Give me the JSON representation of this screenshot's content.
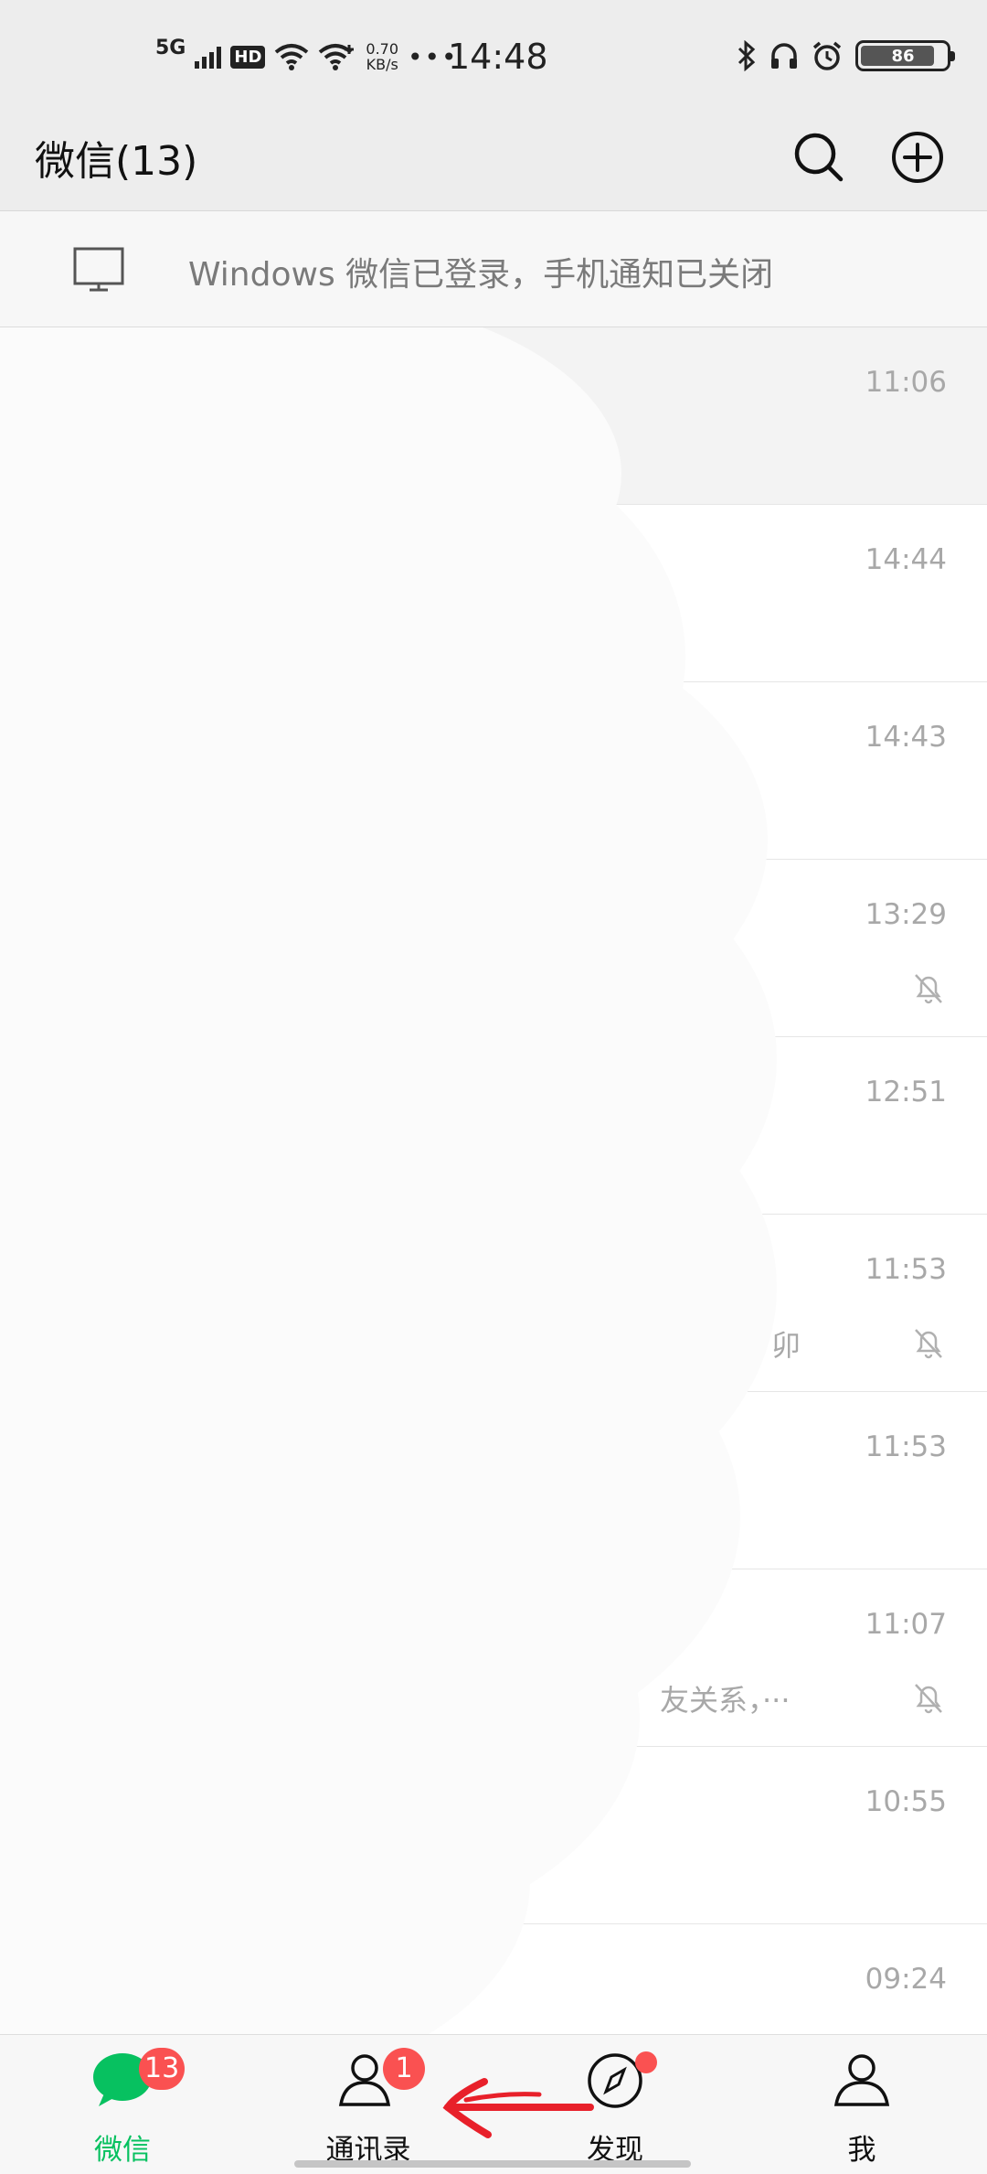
{
  "status_bar": {
    "network": "5G",
    "hd": "HD",
    "speed_value": "0.70",
    "speed_unit": "KB/s",
    "more": "•••",
    "time": "14:48",
    "battery": "86"
  },
  "header": {
    "title": "微信(13)",
    "search_icon": "search-icon",
    "add_icon": "plus-circle-icon"
  },
  "notice": {
    "icon": "monitor-icon",
    "text": "Windows 微信已登录，手机通知已关闭"
  },
  "chats": [
    {
      "time": "11:06",
      "preview": "",
      "muted": false,
      "pinned": true
    },
    {
      "time": "14:44",
      "preview": "",
      "muted": false,
      "pinned": false
    },
    {
      "time": "14:43",
      "preview": "",
      "muted": false,
      "pinned": false
    },
    {
      "time": "13:29",
      "preview": "",
      "muted": true,
      "pinned": false
    },
    {
      "time": "12:51",
      "preview": "",
      "muted": false,
      "pinned": false
    },
    {
      "time": "11:53",
      "preview": "卯",
      "muted": true,
      "pinned": false
    },
    {
      "time": "11:53",
      "preview": "",
      "muted": false,
      "pinned": false
    },
    {
      "time": "11:07",
      "preview": "友关系，···",
      "muted": true,
      "pinned": false
    },
    {
      "time": "10:55",
      "preview": "",
      "muted": false,
      "pinned": false
    },
    {
      "time": "09:24",
      "preview": "",
      "muted": false,
      "pinned": false
    }
  ],
  "tabs": [
    {
      "label": "微信",
      "icon": "chat-bubble-icon",
      "badge": "13",
      "active": true
    },
    {
      "label": "通讯录",
      "icon": "contacts-icon",
      "badge": "1",
      "active": false
    },
    {
      "label": "发现",
      "icon": "compass-icon",
      "badge": "",
      "active": false
    },
    {
      "label": "我",
      "icon": "person-icon",
      "badge": "",
      "active": false
    }
  ],
  "colors": {
    "accent": "#07c160",
    "badge": "#fa5151",
    "header_bg": "#ededed",
    "annotation_arrow": "#e8202a"
  }
}
